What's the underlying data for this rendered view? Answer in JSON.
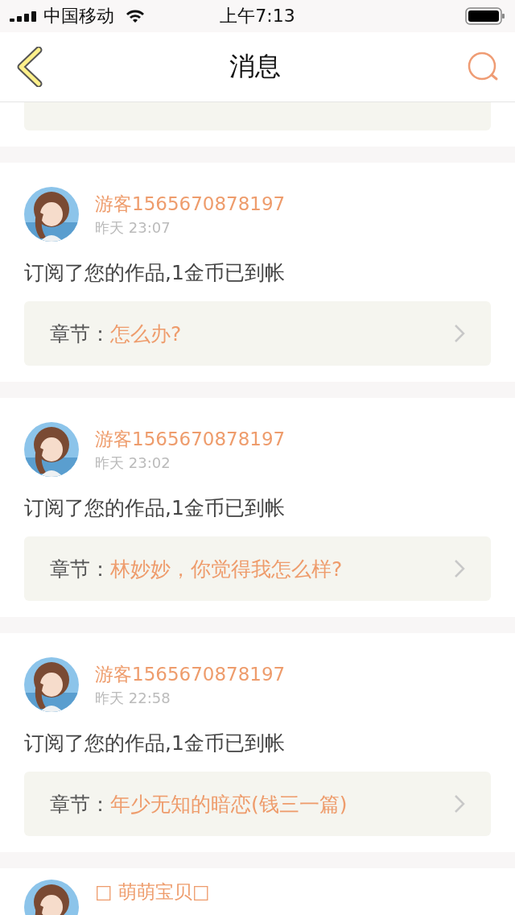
{
  "status_bar": {
    "carrier": "中国移动",
    "time": "上午7:13"
  },
  "nav": {
    "title": "消息"
  },
  "messages": [
    {
      "kind": "partial"
    },
    {
      "kind": "full",
      "sender": "游客1565670878197",
      "time": "昨天 23:07",
      "text": "订阅了您的作品,1金币已到帐",
      "chapter_label": "章节：",
      "chapter": "怎么办?"
    },
    {
      "kind": "full",
      "sender": "游客1565670878197",
      "time": "昨天 23:02",
      "text": "订阅了您的作品,1金币已到帐",
      "chapter_label": "章节：",
      "chapter": "林妙妙，你觉得我怎么样?"
    },
    {
      "kind": "full",
      "sender": "游客1565670878197",
      "time": "昨天 22:58",
      "text": "订阅了您的作品,1金币已到帐",
      "chapter_label": "章节：",
      "chapter": "年少无知的暗恋(钱三一篇)"
    },
    {
      "kind": "header",
      "sender": "□ 萌萌宝贝□"
    }
  ]
}
